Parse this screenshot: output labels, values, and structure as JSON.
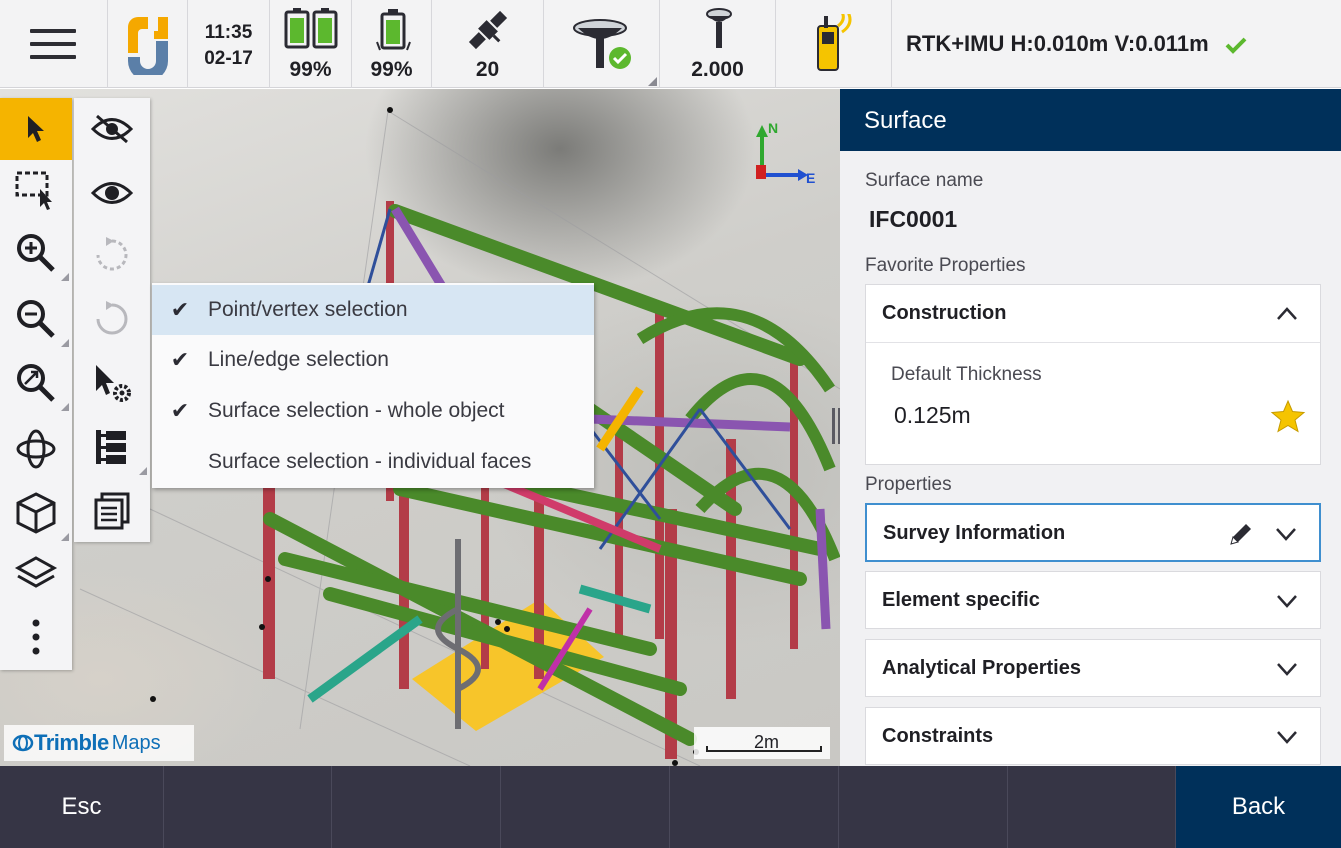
{
  "statusbar": {
    "menu_icon": "hamburger-menu-icon",
    "app_icon": "trimble-access-app-icon",
    "time": "11:35",
    "date": "02-17",
    "battery1": "99%",
    "battery2": "99%",
    "satellites": "20",
    "antenna_height": "2.000",
    "rtk_status": "RTK+IMU H:0.010m V:0.011m",
    "colors": {
      "ok_green": "#5cb82e",
      "app_orange": "#f5a800",
      "app_blue": "#5b7fa8"
    }
  },
  "map": {
    "compass": {
      "north": "N",
      "east": "E"
    },
    "tools": [
      "select-arrow-icon",
      "rectangle-select-icon",
      "zoom-in-icon",
      "zoom-out-icon",
      "zoom-extents-icon",
      "orbit-icon",
      "view-cube-icon",
      "layers-icon",
      "more-vertical-icon"
    ],
    "tools2": [
      "hide-icon",
      "show-icon",
      "undo-icon",
      "redo-icon",
      "selection-settings-icon",
      "tree-icon",
      "list-icon"
    ],
    "selection_menu": {
      "items": [
        {
          "label": "Point/vertex selection",
          "checked": "✔"
        },
        {
          "label": "Line/edge selection",
          "checked": "✔"
        },
        {
          "label": "Surface selection - whole object",
          "checked": "✔"
        },
        {
          "label": "Surface selection - individual faces",
          "checked": ""
        }
      ]
    },
    "logo_brand": "Trimble",
    "logo_product": "Maps",
    "scale_label": "2m",
    "colors": {
      "active_tool": "#f5b400",
      "steel_red": "#b33c48",
      "beam_green": "#4a8a2a",
      "slab_yellow": "#f7c52a"
    }
  },
  "panel": {
    "title": "Surface",
    "surface_name_label": "Surface name",
    "surface_name": "IFC0001",
    "favorite_label": "Favorite Properties",
    "construction": {
      "title": "Construction",
      "field_label": "Default Thickness",
      "field_value": "0.125m",
      "star_color": "#f5c400"
    },
    "properties_label": "Properties",
    "groups": [
      {
        "title": "Survey Information"
      },
      {
        "title": "Element specific"
      },
      {
        "title": "Analytical Properties"
      },
      {
        "title": "Constraints"
      }
    ],
    "header_color": "#00305a"
  },
  "bottombar": {
    "buttons": [
      "Esc",
      "",
      "",
      "",
      "",
      "",
      ""
    ],
    "back": "Back"
  }
}
